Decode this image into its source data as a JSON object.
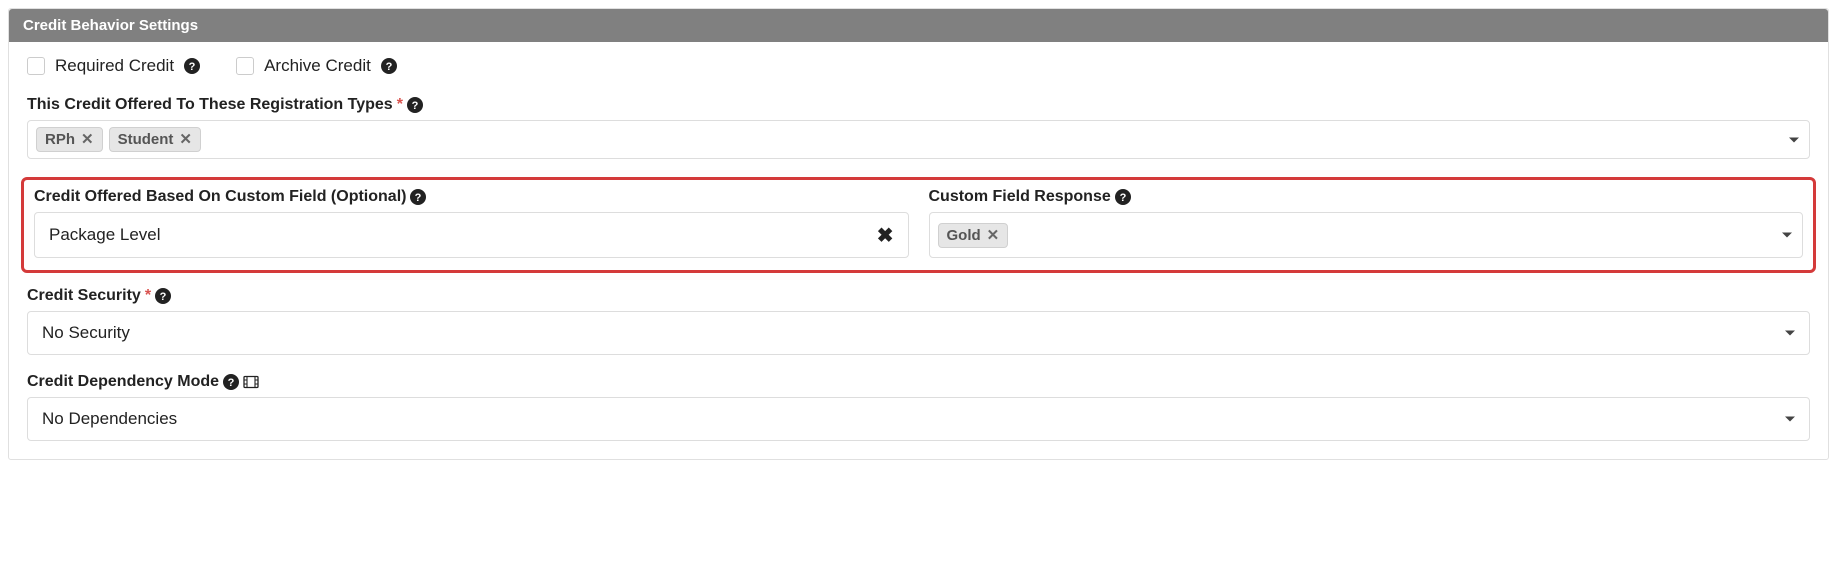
{
  "panel": {
    "title": "Credit Behavior Settings"
  },
  "checks": {
    "required_label": "Required Credit",
    "archive_label": "Archive Credit"
  },
  "reg_types": {
    "label": "This Credit Offered To These Registration Types",
    "tags": {
      "t0": "RPh",
      "t1": "Student"
    }
  },
  "custom_field": {
    "label": "Credit Offered Based On Custom Field (Optional)",
    "value": "Package Level"
  },
  "custom_response": {
    "label": "Custom Field Response",
    "tags": {
      "t0": "Gold"
    }
  },
  "security": {
    "label": "Credit Security",
    "value": "No Security"
  },
  "dependency": {
    "label": "Credit Dependency Mode",
    "value": "No Dependencies"
  }
}
